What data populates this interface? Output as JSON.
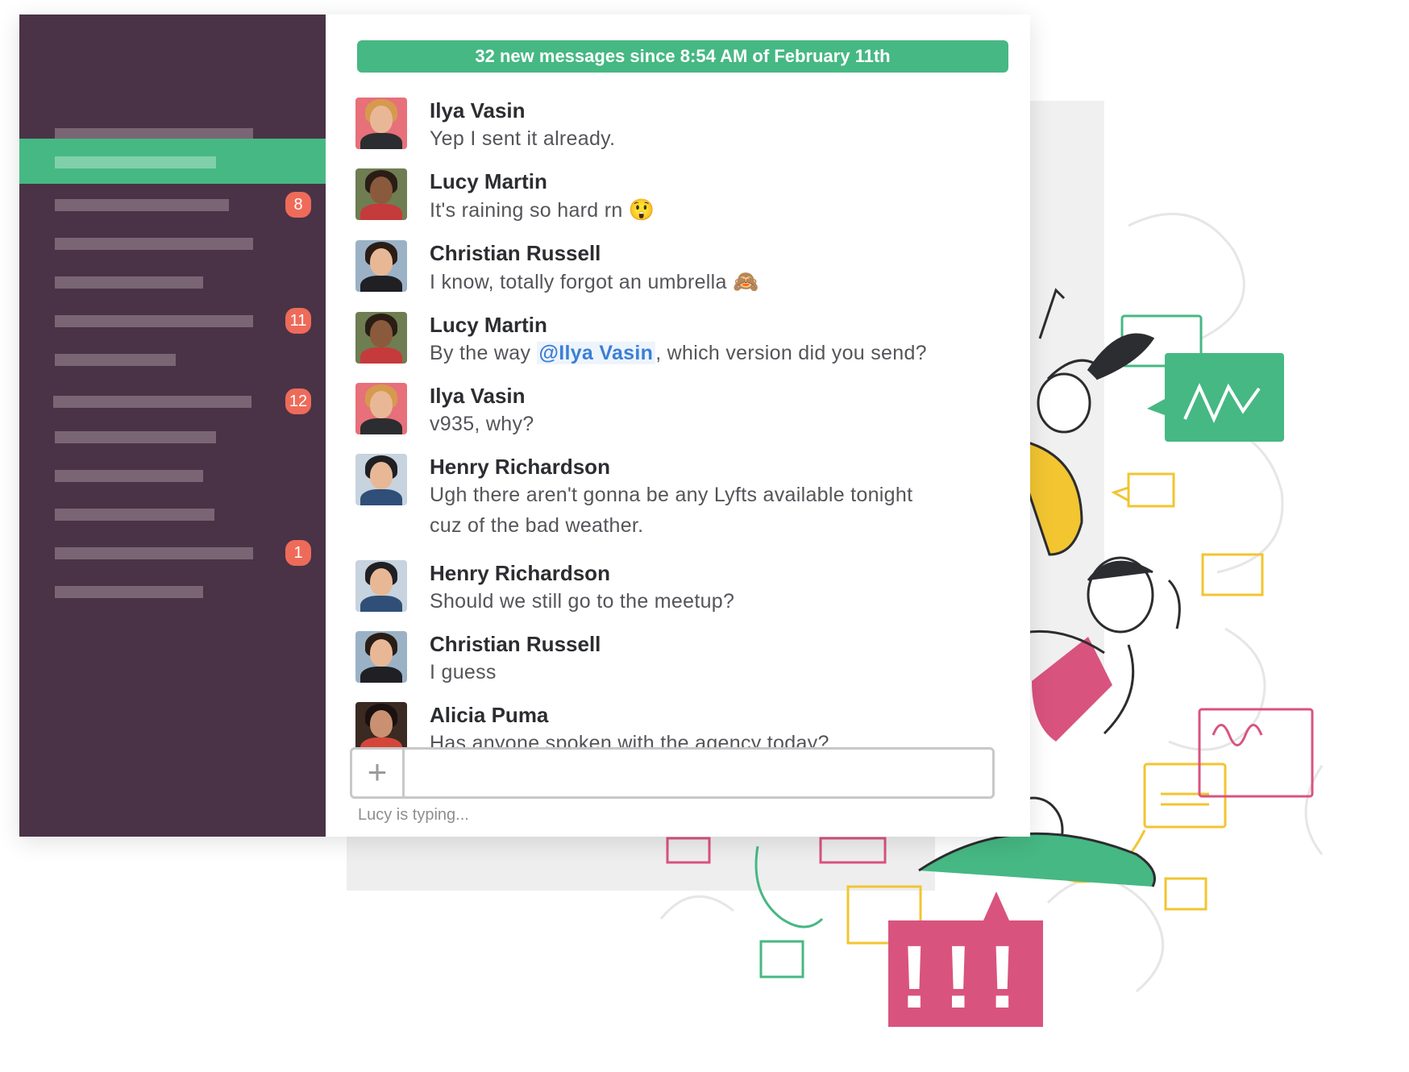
{
  "banner": {
    "text": "32 new messages since 8:54 AM of February 11th"
  },
  "sidebar": {
    "items": [
      {
        "active": false,
        "badge": ""
      },
      {
        "active": true,
        "badge": ""
      },
      {
        "active": false,
        "badge": "8"
      },
      {
        "active": false,
        "badge": ""
      },
      {
        "active": false,
        "badge": ""
      },
      {
        "active": false,
        "badge": "11"
      },
      {
        "active": false,
        "badge": ""
      },
      {
        "active": false,
        "badge": "12"
      },
      {
        "active": false,
        "badge": ""
      },
      {
        "active": false,
        "badge": ""
      },
      {
        "active": false,
        "badge": ""
      },
      {
        "active": false,
        "badge": "1"
      },
      {
        "active": false,
        "badge": ""
      }
    ]
  },
  "messages": [
    {
      "author": "Ilya Vasin",
      "text": "Yep I sent it already."
    },
    {
      "author": "Lucy Martin",
      "text": "It's raining so hard rn",
      "emoji": "😲"
    },
    {
      "author": "Christian Russell",
      "text": "I know, totally forgot an umbrella",
      "emoji": "🙈"
    },
    {
      "author": "Lucy Martin",
      "text_before": "By the way ",
      "mention": "@Ilya Vasin",
      "text_after": ", which version did you send?"
    },
    {
      "author": "Ilya Vasin",
      "text": "v935, why?"
    },
    {
      "author": "Henry Richardson",
      "text": "Ugh there aren't gonna be any Lyfts available tonight cuz of the bad weather."
    },
    {
      "author": "Henry Richardson",
      "text": "Should we still go to the meetup?"
    },
    {
      "author": "Christian Russell",
      "text": "I guess"
    },
    {
      "author": "Alicia Puma",
      "text": "Has anyone spoken with the agency today?"
    }
  ],
  "composer": {
    "plus_label": "+",
    "value": "",
    "placeholder": "",
    "typing_indicator": "Lucy is typing..."
  },
  "illustration": {
    "panel_text": "!!!"
  },
  "colors": {
    "sidebar_bg": "#4a3346",
    "accent_green": "#46b883",
    "badge_red": "#ee6b5a",
    "mention_blue": "#3b7fd6",
    "illustration_pink": "#d9537f",
    "illustration_yellow": "#f2c531"
  }
}
